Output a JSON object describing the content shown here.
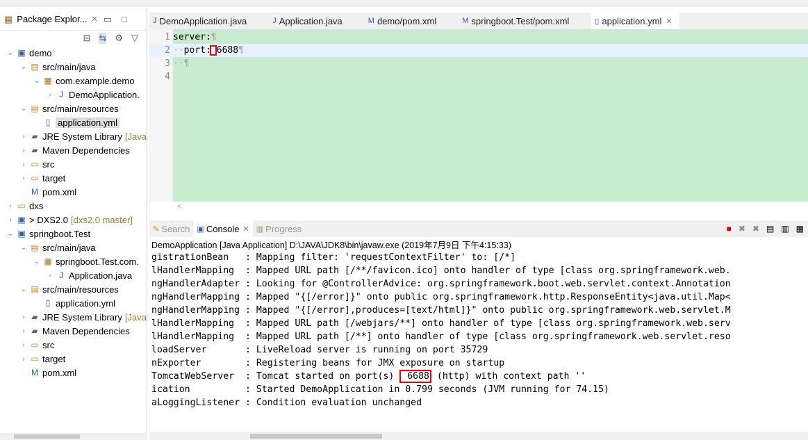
{
  "package_explorer": {
    "title": "Package Explor...",
    "tree": [
      {
        "label": "demo",
        "depth": 0,
        "expanded": true,
        "icon": "project-icon"
      },
      {
        "label": "src/main/java",
        "depth": 1,
        "expanded": true,
        "icon": "source-folder-icon"
      },
      {
        "label": "com.example.demo",
        "depth": 2,
        "expanded": true,
        "icon": "package-icon"
      },
      {
        "label": "DemoApplication.",
        "depth": 3,
        "expanded": false,
        "icon": "java-file-icon"
      },
      {
        "label": "src/main/resources",
        "depth": 1,
        "expanded": true,
        "icon": "source-folder-icon"
      },
      {
        "label": "application.yml",
        "depth": 2,
        "leaf": true,
        "selected": true,
        "icon": "file-icon"
      },
      {
        "label": "JRE System Library",
        "extra": "[Java",
        "depth": 1,
        "expanded": false,
        "icon": "library-icon"
      },
      {
        "label": "Maven Dependencies",
        "depth": 1,
        "expanded": false,
        "icon": "library-icon"
      },
      {
        "label": "src",
        "depth": 1,
        "expanded": false,
        "icon": "folder-icon"
      },
      {
        "label": "target",
        "depth": 1,
        "expanded": false,
        "icon": "folder-icon"
      },
      {
        "label": "pom.xml",
        "depth": 1,
        "leaf": true,
        "icon": "maven-file-icon"
      },
      {
        "label": "dxs",
        "depth": 0,
        "expanded": false,
        "icon": "folder-icon"
      },
      {
        "label": "> DXS2.0",
        "extra": "[dxs2.0 master]",
        "depth": 0,
        "expanded": false,
        "icon": "project-icon"
      },
      {
        "label": "springboot.Test",
        "depth": 0,
        "expanded": true,
        "icon": "project-icon"
      },
      {
        "label": "src/main/java",
        "depth": 1,
        "expanded": true,
        "icon": "source-folder-icon"
      },
      {
        "label": "springboot.Test.com.",
        "depth": 2,
        "expanded": true,
        "icon": "package-icon"
      },
      {
        "label": "Application.java",
        "depth": 3,
        "expanded": false,
        "icon": "java-file-icon"
      },
      {
        "label": "src/main/resources",
        "depth": 1,
        "expanded": true,
        "icon": "source-folder-icon"
      },
      {
        "label": "application.yml",
        "depth": 2,
        "leaf": true,
        "icon": "file-icon"
      },
      {
        "label": "JRE System Library",
        "extra": "[Java",
        "depth": 1,
        "expanded": false,
        "icon": "library-icon"
      },
      {
        "label": "Maven Dependencies",
        "depth": 1,
        "expanded": false,
        "icon": "library-icon"
      },
      {
        "label": "src",
        "depth": 1,
        "expanded": false,
        "icon": "folder-icon"
      },
      {
        "label": "target",
        "depth": 1,
        "expanded": false,
        "icon": "folder-icon"
      },
      {
        "label": "pom.xml",
        "depth": 1,
        "leaf": true,
        "icon": "maven-file-icon"
      }
    ]
  },
  "editor": {
    "tabs": [
      {
        "label": "DemoApplication.java",
        "icon": "java-file-icon"
      },
      {
        "label": "Application.java",
        "icon": "java-file-icon"
      },
      {
        "label": "demo/pom.xml",
        "icon": "maven-file-icon"
      },
      {
        "label": "springboot.Test/pom.xml",
        "icon": "maven-file-icon"
      },
      {
        "label": "application.yml",
        "icon": "file-icon",
        "active": true
      }
    ],
    "lines": [
      {
        "num": "1",
        "indent": "",
        "text": "server:"
      },
      {
        "num": "2",
        "indent": "··",
        "text": "port:",
        "value": "6688"
      },
      {
        "num": "3",
        "indent": "··",
        "text": ""
      },
      {
        "num": "4",
        "indent": "",
        "text": ""
      }
    ],
    "background": "#c9ebd0"
  },
  "console": {
    "tabs": [
      {
        "label": "Search",
        "icon": "search-icon"
      },
      {
        "label": "Console",
        "icon": "console-icon",
        "active": true
      },
      {
        "label": "Progress",
        "icon": "progress-icon"
      }
    ],
    "header": "DemoApplication [Java Application] D:\\JAVA\\JDK8\\bin\\javaw.exe (2019年7月9日 下午4:15:33)",
    "lines": [
      "gistrationBean   : Mapping filter: 'requestContextFilter' to: [/*]",
      "lHandlerMapping  : Mapped URL path [/**/favicon.ico] onto handler of type [class org.springframework.web.",
      "ngHandlerAdapter : Looking for @ControllerAdvice: org.springframework.boot.web.servlet.context.Annotation",
      "ngHandlerMapping : Mapped \"{[/error]}\" onto public org.springframework.http.ResponseEntity<java.util.Map<",
      "ngHandlerMapping : Mapped \"{[/error],produces=[text/html]}\" onto public org.springframework.web.servlet.M",
      "lHandlerMapping  : Mapped URL path [/webjars/**] onto handler of type [class org.springframework.web.serv",
      "lHandlerMapping  : Mapped URL path [/**] onto handler of type [class org.springframework.web.servlet.reso",
      "loadServer       : LiveReload server is running on port 35729",
      "nExporter        : Registering beans for JMX exposure on startup",
      "ication          : Started DemoApplication in 0.799 seconds (JVM running for 74.15)",
      "aLoggingListener : Condition evaluation unchanged"
    ],
    "tomcat_line": {
      "prefix": "TomcatWebServer  : Tomcat started on port(s) ",
      "port": " 6688",
      "suffix": " (http) with context path ''"
    }
  }
}
